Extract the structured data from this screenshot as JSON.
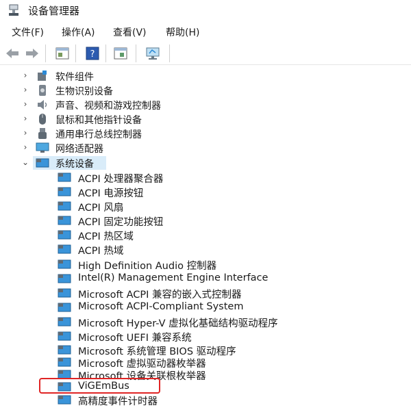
{
  "window": {
    "title": "设备管理器"
  },
  "menu": [
    "文件(F)",
    "操作(A)",
    "查看(V)",
    "帮助(H)"
  ],
  "toolbar": {
    "buttons": [
      "back-arrow-icon",
      "forward-arrow-icon",
      "properties-icon",
      "help-icon",
      "update-driver-icon",
      "scan-hardware-icon"
    ]
  },
  "tree": {
    "categories": [
      {
        "label": "软件组件",
        "icon": "software-component-icon",
        "expanded": false
      },
      {
        "label": "生物识别设备",
        "icon": "biometric-icon",
        "expanded": false
      },
      {
        "label": "声音、视频和游戏控制器",
        "icon": "sound-icon",
        "expanded": false
      },
      {
        "label": "鼠标和其他指针设备",
        "icon": "mouse-icon",
        "expanded": false
      },
      {
        "label": "通用串行总线控制器",
        "icon": "usb-icon",
        "expanded": false
      },
      {
        "label": "网络适配器",
        "icon": "network-adapter-icon",
        "expanded": false
      },
      {
        "label": "系统设备",
        "icon": "system-device-icon",
        "expanded": true
      }
    ],
    "system_devices": [
      "ACPI 处理器聚合器",
      "ACPI 电源按钮",
      "ACPI 风扇",
      "ACPI 固定功能按钮",
      "ACPI 热区域",
      "ACPI 热域",
      "High Definition Audio 控制器",
      "Intel(R) Management Engine Interface",
      "Microsoft ACPI 兼容的嵌入式控制器",
      "Microsoft ACPI-Compliant System",
      "Microsoft Hyper-V 虚拟化基础结构驱动程序",
      "Microsoft UEFI 兼容系统",
      "Microsoft 系统管理 BIOS 驱动程序",
      "Microsoft 虚拟驱动器枚举器",
      "Microsoft 设备关联根枚举器",
      "ViGEmBus",
      "高精度事件计时器"
    ],
    "highlighted_device": "ViGEmBus"
  },
  "colors": {
    "highlight_border": "#e02424",
    "selection_bg": "#d9ecf9",
    "device_icon": "#2b8ad6"
  }
}
